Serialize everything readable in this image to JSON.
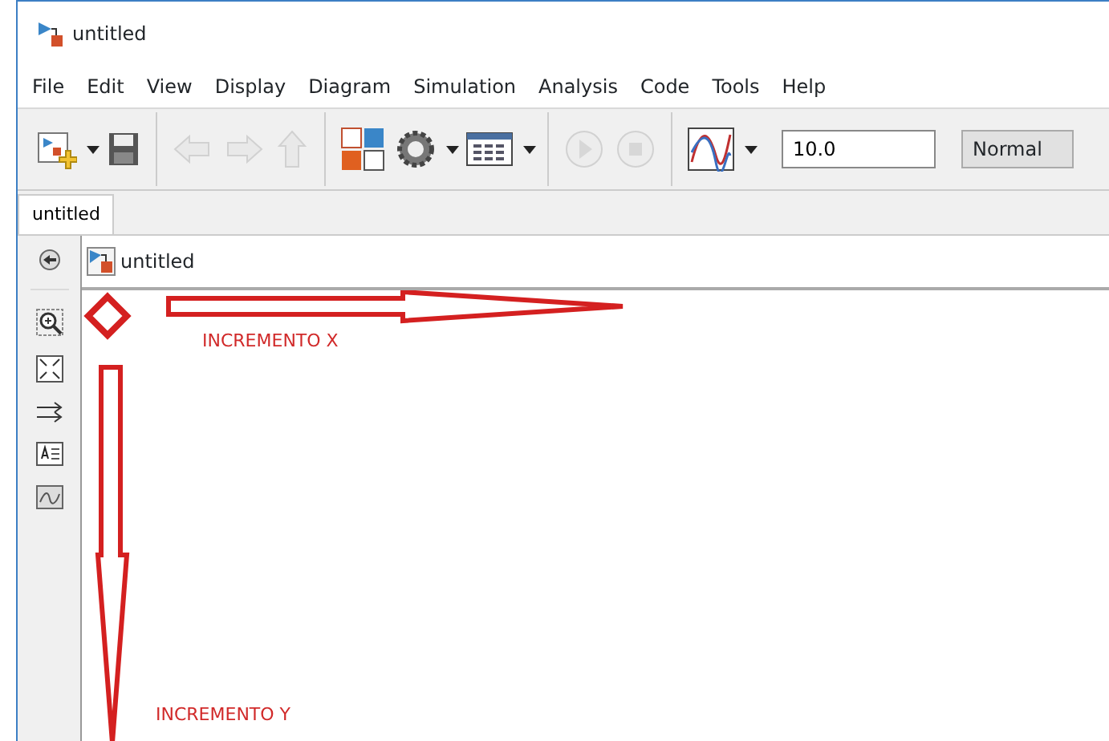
{
  "window": {
    "title": "untitled"
  },
  "menu": [
    "File",
    "Edit",
    "View",
    "Display",
    "Diagram",
    "Simulation",
    "Analysis",
    "Code",
    "Tools",
    "Help"
  ],
  "toolbar": {
    "buttons": [
      {
        "disabled": false,
        "dropdown": true
      },
      {
        "disabled": false,
        "dropdown": false
      },
      {
        "disabled": true,
        "dropdown": false
      },
      {
        "disabled": true,
        "dropdown": false
      },
      {
        "disabled": true,
        "dropdown": false
      },
      {
        "disabled": false,
        "dropdown": false
      },
      {
        "disabled": false,
        "dropdown": true
      },
      {
        "disabled": false,
        "dropdown": true
      },
      {
        "disabled": true,
        "dropdown": false
      },
      {
        "disabled": true,
        "dropdown": false
      },
      {
        "disabled": false,
        "dropdown": true
      }
    ],
    "stop_time": "10.0",
    "mode": "Normal"
  },
  "tabs": [
    {
      "label": "untitled",
      "selected": true
    }
  ],
  "breadcrumb": "untitled",
  "annotations": [
    {
      "kind": "x",
      "label": "INCREMENTO X"
    },
    {
      "kind": "y",
      "label": "INCREMENTO Y"
    }
  ]
}
